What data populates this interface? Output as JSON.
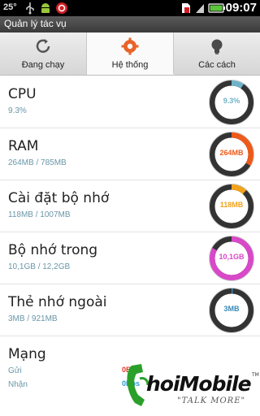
{
  "statusbar": {
    "temperature": "25°",
    "time": "09:07",
    "icons": [
      "usb-icon",
      "android-debug-icon",
      "beats-audio-icon",
      "sd-card-warning-icon",
      "signal-icon",
      "battery-charging-icon"
    ]
  },
  "app": {
    "title": "Quản lý tác vụ"
  },
  "tabs": [
    {
      "label": "Đang chạy",
      "icon": "refresh-icon",
      "active": false
    },
    {
      "label": "Hệ thống",
      "icon": "gear-icon",
      "active": true
    },
    {
      "label": "Các cách",
      "icon": "lightbulb-icon",
      "active": false
    }
  ],
  "rows": [
    {
      "title": "CPU",
      "subtitle": "9.3%",
      "gauge_value": "9.3%",
      "fraction": 0.093,
      "color": "#6fb3c9"
    },
    {
      "title": "RAM",
      "subtitle": "264MB / 785MB",
      "gauge_value": "264MB",
      "fraction": 0.336,
      "color": "#ee5a1a"
    },
    {
      "title": "Cài đặt bộ nhớ",
      "subtitle": "118MB / 1007MB",
      "gauge_value": "118MB",
      "fraction": 0.117,
      "color": "#f2a21b"
    },
    {
      "title": "Bộ nhớ trong",
      "subtitle": "10,1GB / 12,2GB",
      "gauge_value": "10,1GB",
      "fraction": 0.828,
      "color": "#d848c8"
    },
    {
      "title": "Thẻ nhớ ngoài",
      "subtitle": "3MB / 921MB",
      "gauge_value": "3MB",
      "fraction": 0.003,
      "color": "#3a8ab8"
    }
  ],
  "network": {
    "title": "Mạng",
    "sent_label": "Gửi",
    "received_label": "Nhận",
    "sent_value": "0Bps",
    "received_value": "0Bps",
    "sent_color": "#e23a2a",
    "received_color": "#2a9ad0"
  },
  "watermark": {
    "brand": "hoiMobile",
    "tagline": "\"TALK MORE\"",
    "trademark": "TM"
  }
}
